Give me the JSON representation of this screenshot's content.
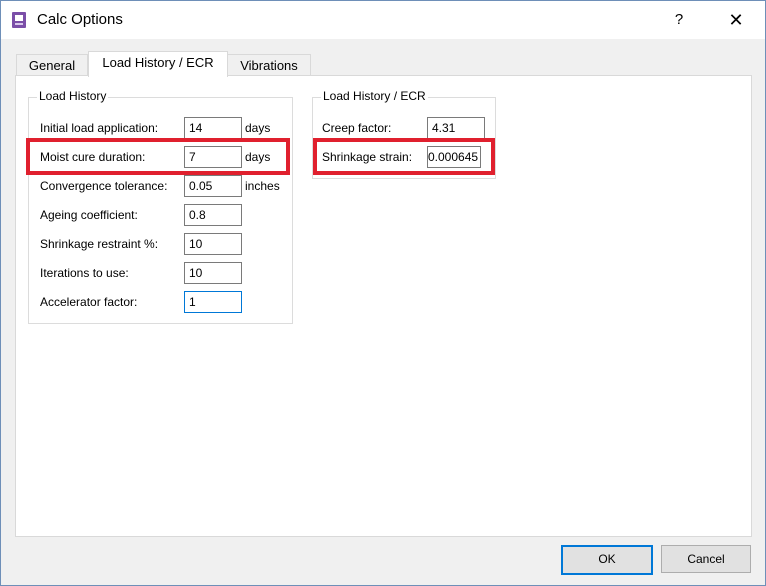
{
  "window": {
    "title": "Calc Options",
    "help": "?",
    "close": "✕"
  },
  "tabs": [
    {
      "label": "General",
      "active": false
    },
    {
      "label": "Load History / ECR",
      "active": true
    },
    {
      "label": "Vibrations",
      "active": false
    }
  ],
  "load_history": {
    "title": "Load History",
    "rows": [
      {
        "label": "Initial load application:",
        "value": "14",
        "unit": "days"
      },
      {
        "label": "Moist cure duration:",
        "value": "7",
        "unit": "days"
      },
      {
        "label": "Convergence tolerance:",
        "value": "0.05",
        "unit": "inches"
      },
      {
        "label": "Ageing coefficient:",
        "value": "0.8",
        "unit": ""
      },
      {
        "label": "Shrinkage restraint %:",
        "value": "10",
        "unit": ""
      },
      {
        "label": "Iterations to use:",
        "value": "10",
        "unit": ""
      },
      {
        "label": "Accelerator factor:",
        "value": "1",
        "unit": ""
      }
    ]
  },
  "ecr": {
    "title": "Load History / ECR",
    "rows": [
      {
        "label": "Creep factor:",
        "value": "4.31"
      },
      {
        "label": "Shrinkage strain:",
        "value": "0.000645"
      }
    ]
  },
  "buttons": {
    "ok": "OK",
    "cancel": "Cancel"
  },
  "colors": {
    "highlight": "#e0202e",
    "focus": "#0078d7"
  }
}
